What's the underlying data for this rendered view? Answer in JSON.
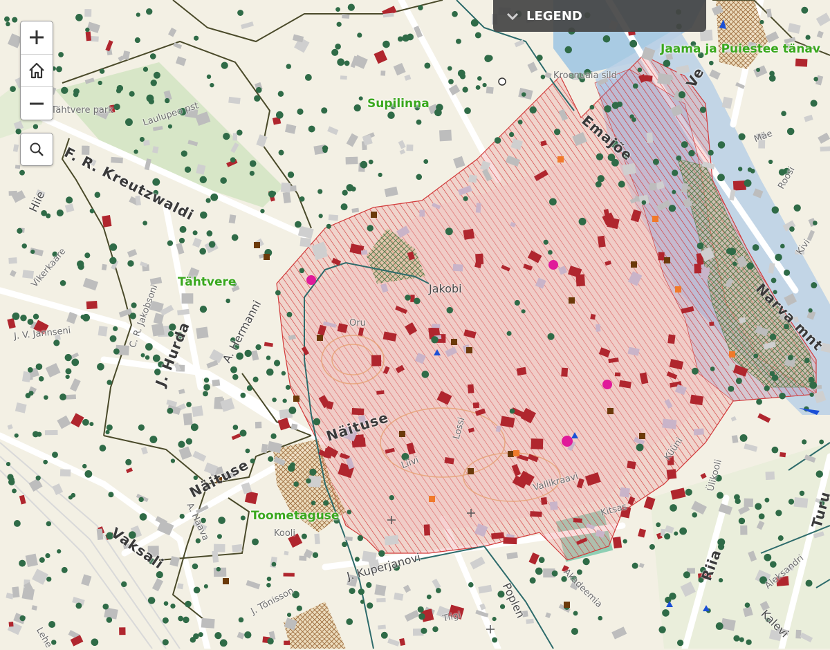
{
  "controls": {
    "zoom_in_icon": "plus-icon",
    "home_icon": "home-icon",
    "zoom_out_icon": "minus-icon",
    "search_icon": "search-icon"
  },
  "legend": {
    "label": "LEGEND",
    "icon": "chevron-down-icon"
  },
  "districts": {
    "supilinna": "Supilinna",
    "tahtvere": "Tähtvere",
    "toometaguse": "Toometaguse",
    "jaama": "Jaama ja Puiestee tänav"
  },
  "streets": {
    "kreutzwaldi": "F. R. Kreutzwaldi",
    "tahtvere_park": "Tähtvere park",
    "laulupeo": "Laulupeo pst",
    "hiie": "Hiie",
    "vikerkaare": "Vikerkaare",
    "jannseni": "J. V. Jannseni",
    "hurda": "J. Hurda",
    "hermanni": "A. Hermanni",
    "jakobsoni": "C. R. Jakobsoni",
    "kroonuaia": "Kroonuaia sild",
    "emajoe": "Emajõe",
    "jakobi": "Jakobi",
    "oru": "Oru",
    "naituse_main": "Näituse",
    "naituse_w": "Näituse",
    "lossi": "Lossi",
    "liivi": "Liivi",
    "vallikraavi": "Vallikraavi",
    "kuuni": "Küüni",
    "ulikooli": "Ülikooli",
    "kitsas": "Kitsas",
    "riia": "Riia",
    "turu": "Turu",
    "vaksali": "Vaksali",
    "kuperjanovi": "J. Kuperjanovi",
    "akadeemia": "Akadeemia",
    "poe": "Poe",
    "haava": "A. Haava",
    "kooli": "Kooli",
    "toomse": "J. Tõnisson",
    "aleksandri": "Aleksandri",
    "kalevi": "Kalevi",
    "narva": "Narva mnt",
    "vabaduse": "Ve",
    "kivi": "Kivi",
    "lehe": "Lehe",
    "tiigi": "Tiigi",
    "popler": "Poplen",
    "mae": "Mäe",
    "ropsi": "Roosi"
  },
  "colors": {
    "background": "#f3f0e4",
    "district_label": "#3aa81e",
    "protected_zone_hatch": "#d23a3a",
    "building_heritage": "#b0262e",
    "trees": "#2f6b47",
    "river": "#a9cbe3",
    "boundary": "#4a4a2a"
  }
}
